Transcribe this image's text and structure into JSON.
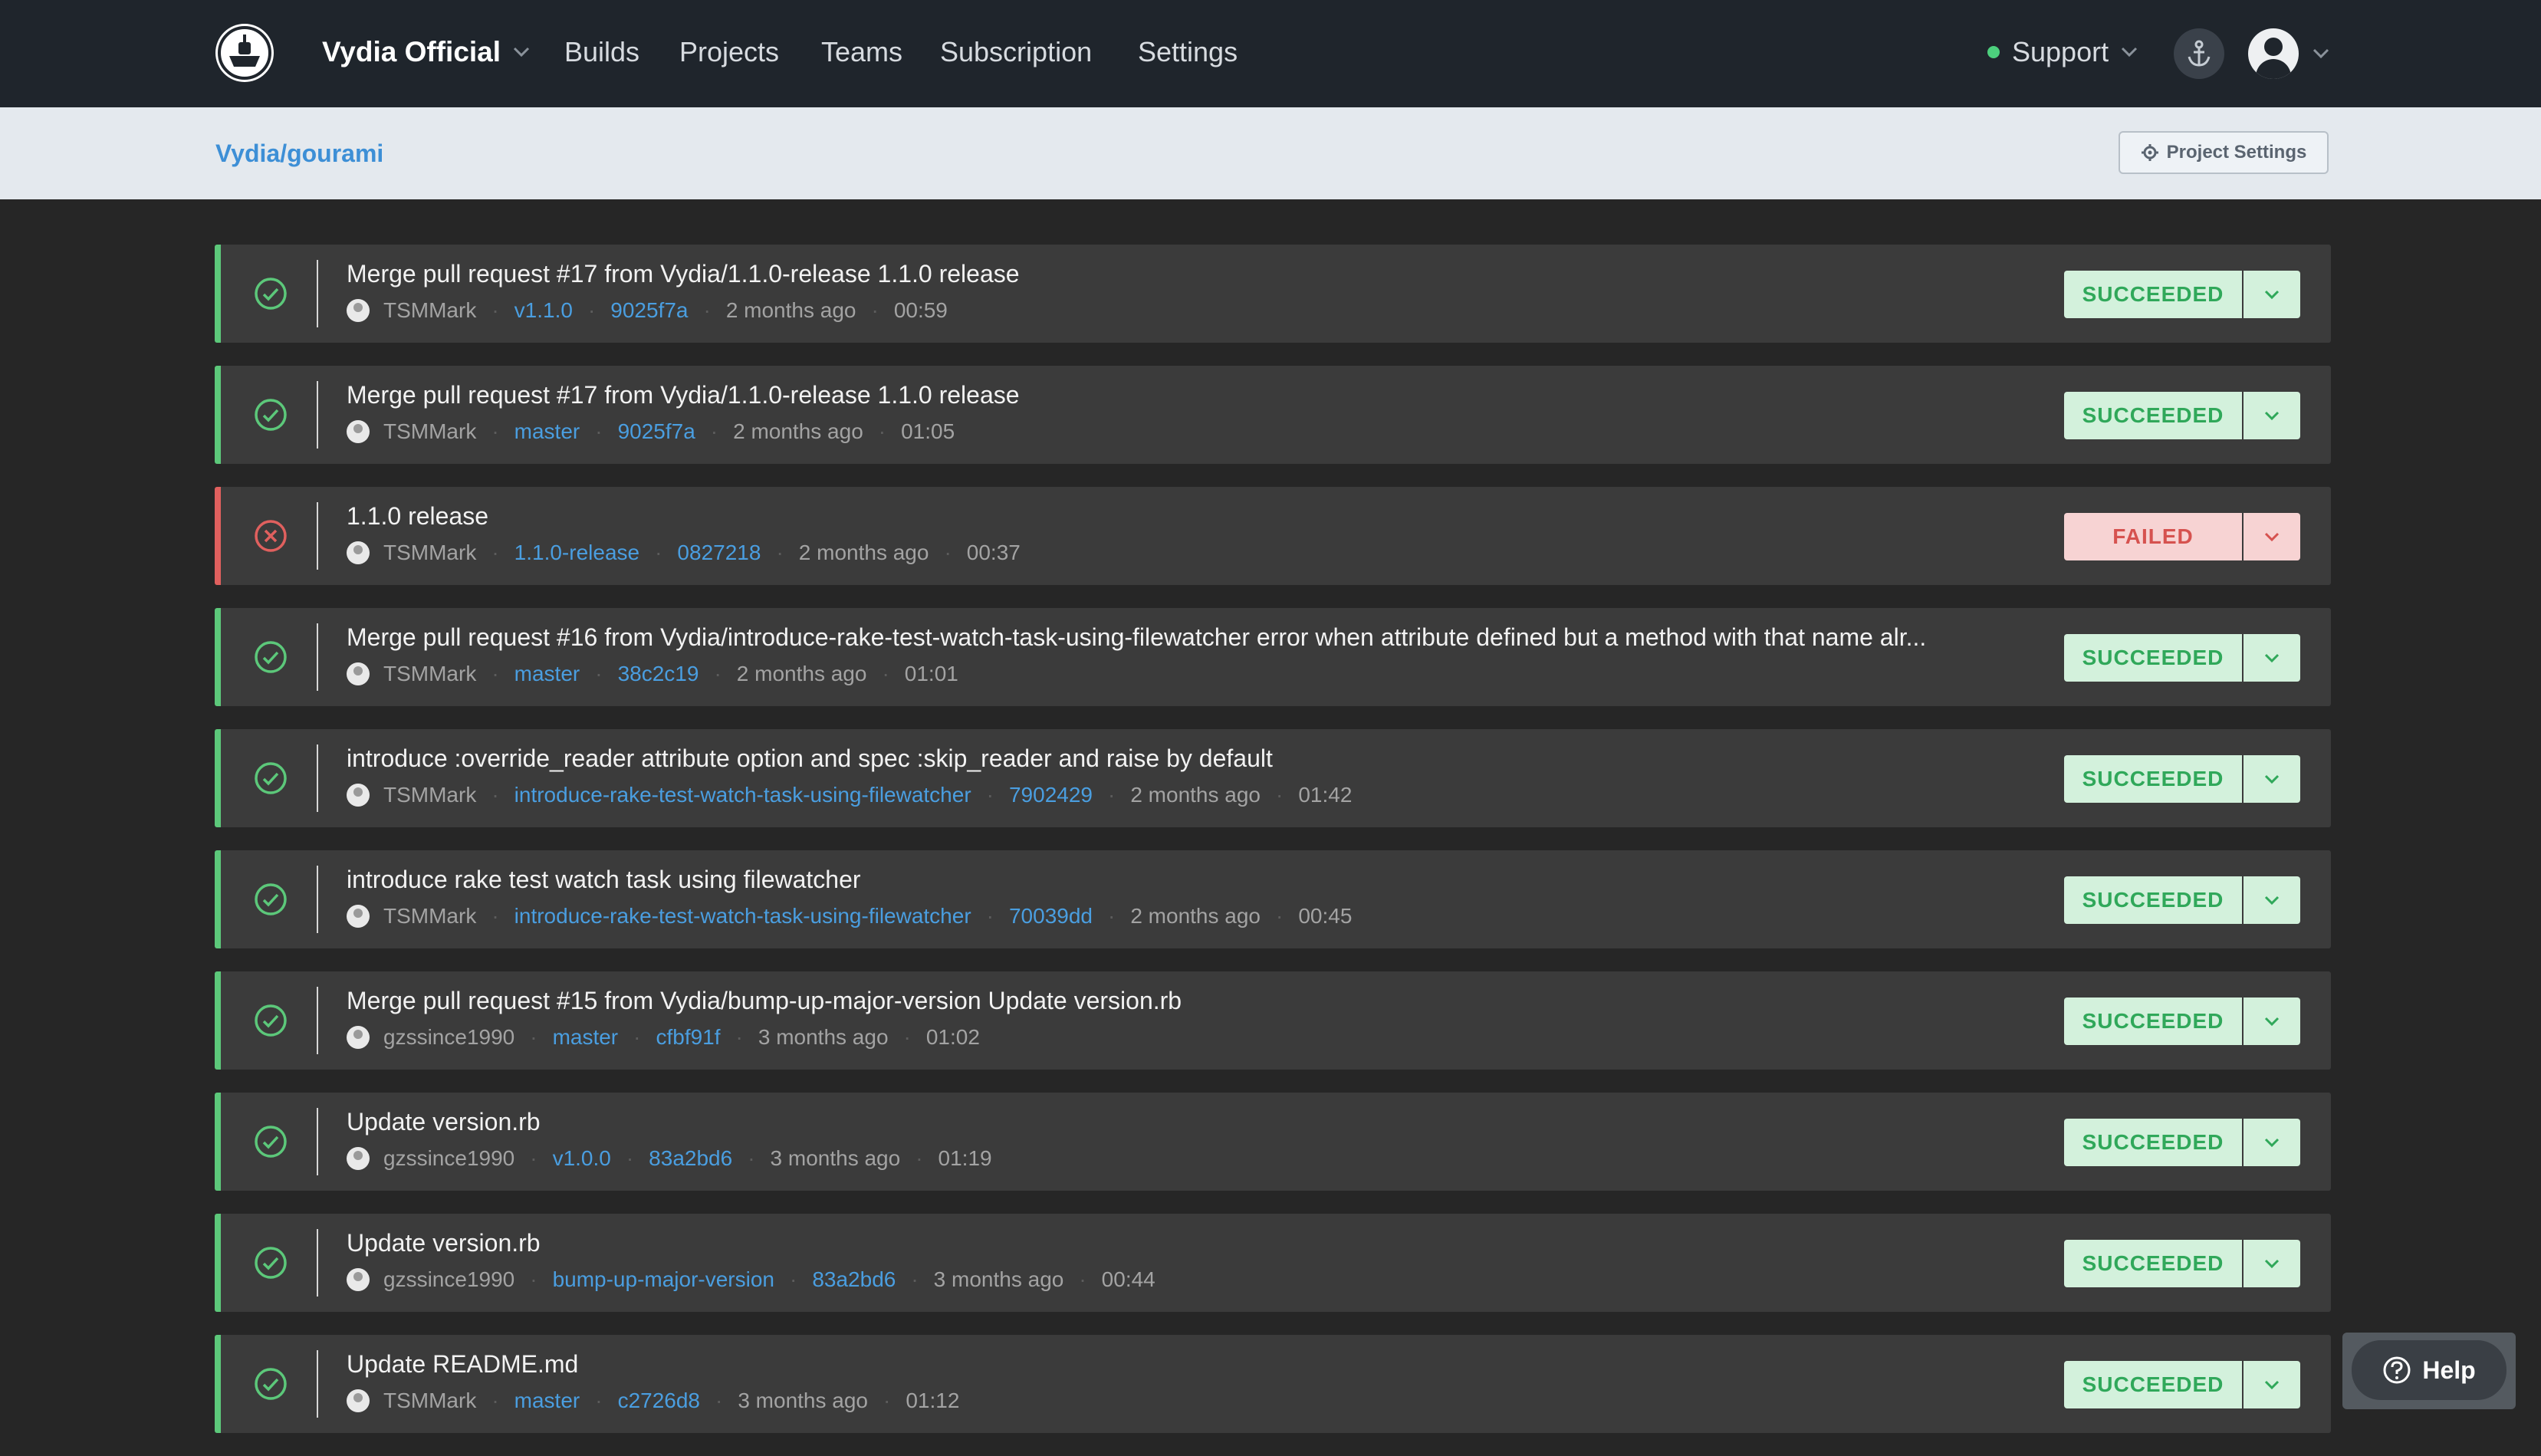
{
  "header": {
    "org_name": "Vydia Official",
    "nav": [
      "Builds",
      "Projects",
      "Teams",
      "Subscription",
      "Settings"
    ],
    "support_label": "Support",
    "support_status_color": "#4cd07d"
  },
  "subheader": {
    "breadcrumb": "Vydia/gourami",
    "project_settings_label": "Project Settings"
  },
  "colors": {
    "success": "#5cc87a",
    "failed": "#e0605e",
    "link": "#4a9ee0"
  },
  "builds": [
    {
      "title": "Merge pull request #17 from Vydia/1.1.0-release 1.1.0 release",
      "author": "TSMMark",
      "ref": "v1.1.0",
      "sha": "9025f7a",
      "age": "2 months ago",
      "duration": "00:59",
      "status": "SUCCEEDED"
    },
    {
      "title": "Merge pull request #17 from Vydia/1.1.0-release 1.1.0 release",
      "author": "TSMMark",
      "ref": "master",
      "sha": "9025f7a",
      "age": "2 months ago",
      "duration": "01:05",
      "status": "SUCCEEDED"
    },
    {
      "title": "1.1.0 release",
      "author": "TSMMark",
      "ref": "1.1.0-release",
      "sha": "0827218",
      "age": "2 months ago",
      "duration": "00:37",
      "status": "FAILED"
    },
    {
      "title": "Merge pull request #16 from Vydia/introduce-rake-test-watch-task-using-filewatcher error when attribute defined but a method with that name alr...",
      "author": "TSMMark",
      "ref": "master",
      "sha": "38c2c19",
      "age": "2 months ago",
      "duration": "01:01",
      "status": "SUCCEEDED"
    },
    {
      "title": "introduce :override_reader attribute option and spec :skip_reader and raise by default",
      "author": "TSMMark",
      "ref": "introduce-rake-test-watch-task-using-filewatcher",
      "sha": "7902429",
      "age": "2 months ago",
      "duration": "01:42",
      "status": "SUCCEEDED"
    },
    {
      "title": "introduce rake test watch task using filewatcher",
      "author": "TSMMark",
      "ref": "introduce-rake-test-watch-task-using-filewatcher",
      "sha": "70039dd",
      "age": "2 months ago",
      "duration": "00:45",
      "status": "SUCCEEDED"
    },
    {
      "title": "Merge pull request #15 from Vydia/bump-up-major-version Update version.rb",
      "author": "gzssince1990",
      "ref": "master",
      "sha": "cfbf91f",
      "age": "3 months ago",
      "duration": "01:02",
      "status": "SUCCEEDED"
    },
    {
      "title": "Update version.rb",
      "author": "gzssince1990",
      "ref": "v1.0.0",
      "sha": "83a2bd6",
      "age": "3 months ago",
      "duration": "01:19",
      "status": "SUCCEEDED"
    },
    {
      "title": "Update version.rb",
      "author": "gzssince1990",
      "ref": "bump-up-major-version",
      "sha": "83a2bd6",
      "age": "3 months ago",
      "duration": "00:44",
      "status": "SUCCEEDED"
    },
    {
      "title": "Update README.md",
      "author": "TSMMark",
      "ref": "master",
      "sha": "c2726d8",
      "age": "3 months ago",
      "duration": "01:12",
      "status": "SUCCEEDED"
    }
  ],
  "help_label": "Help"
}
